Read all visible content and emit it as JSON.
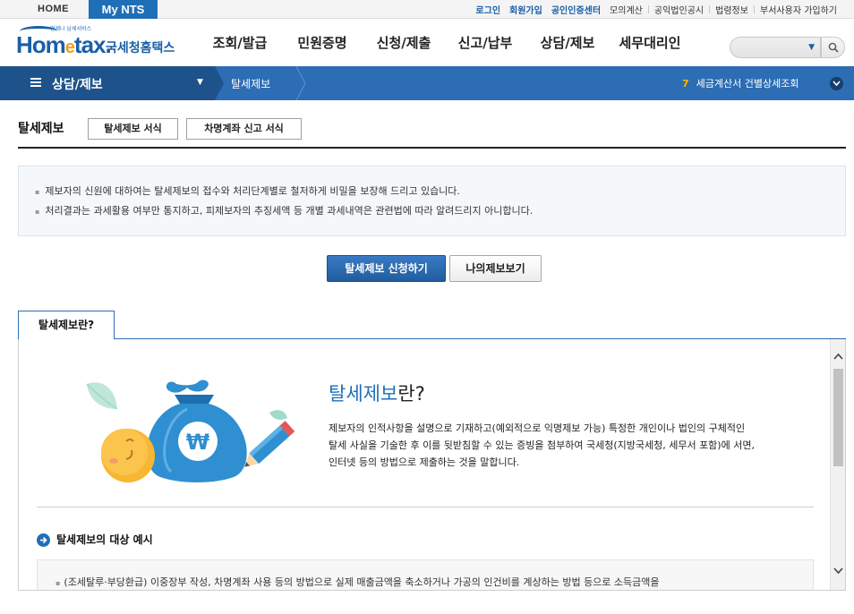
{
  "top": {
    "home": "HOME",
    "mynts": "My NTS",
    "links_blue": [
      "로그인",
      "회원가입",
      "공인인증센터"
    ],
    "links": [
      "모의계산",
      "공익법인공시",
      "법령정보",
      "부서사용자 가입하기"
    ]
  },
  "logo": {
    "small": "언제나 납세서비스",
    "main_a": "Hom",
    "main_e": "e",
    "main_b": "tax.",
    "korean": "국세청홈택스"
  },
  "gnb": [
    "조회/발급",
    "민원증명",
    "신청/제출",
    "신고/납부",
    "상담/제보",
    "세무대리인"
  ],
  "search": {
    "placeholder": ""
  },
  "location": {
    "main": "상담/제보",
    "sub": "탈세제보",
    "recent_num": "7",
    "recent_text": "세금계산서 건별상세조회"
  },
  "page": {
    "title": "탈세제보",
    "btn_form1": "탈세제보 서식",
    "btn_form2": "차명계좌 신고 서식"
  },
  "info": [
    "제보자의 신원에 대하여는 탈세제보의 접수와 처리단계별로 철저하게 비밀을 보장해 드리고 있습니다.",
    "처리결과는 과세활용 여부만 통지하고, 피제보자의 추징세액 등 개별 과세내역은 관련법에 따라 알려드리지 아니합니다."
  ],
  "actions": {
    "apply": "탈세제보 신청하기",
    "mine": "나의제보보기"
  },
  "tab": {
    "label": "탈세제보란?"
  },
  "content": {
    "heading_blue": "탈세제보",
    "heading_tail": "란?",
    "desc": [
      "제보자의 인적사항을 설명으로 기재하고(예외적으로 익명제보 가능) 특정한 개인이나 법인의 구체적인",
      "탈세 사실을 기술한 후 이를 뒷받침할 수 있는 증빙을 첨부하여 국세청(지방국세청, 세무서 포함)에 서면,",
      "인터넷 등의 방법으로 제출하는 것을 말합니다."
    ],
    "section_title": "탈세제보의 대상 예시",
    "example": "(조세탈루·부당환급) 이중장부 작성, 차명계좌 사용 등의 방법으로 실제 매출금액을 축소하거나 가공의 인건비를 계상하는 방법 등으로 소득금액을"
  },
  "colors": {
    "brand_blue": "#1f6fb8",
    "loc_bar": "#2c6db4",
    "loc_dark": "#1e528b",
    "accent_orange": "#f39c1d"
  }
}
